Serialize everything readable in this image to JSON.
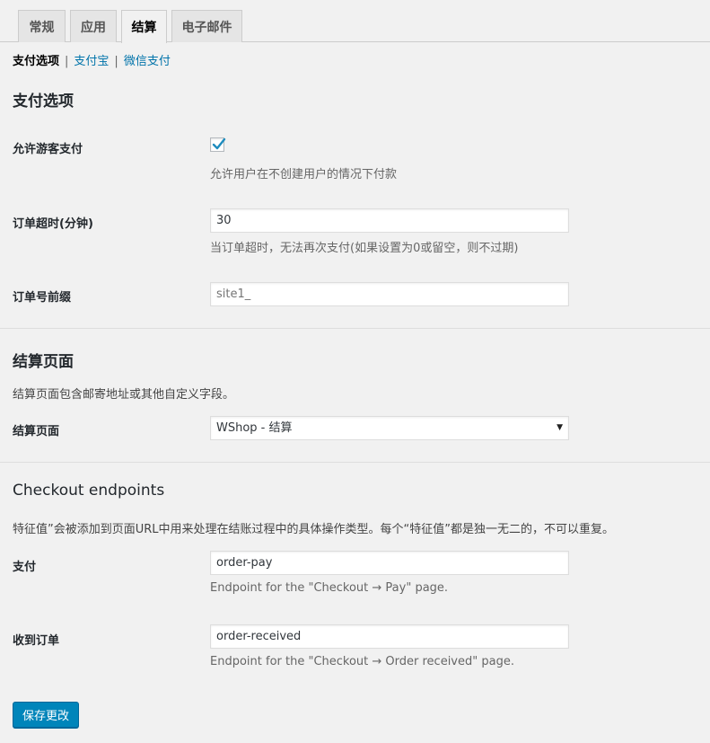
{
  "tabs": [
    {
      "label": "常规",
      "active": false
    },
    {
      "label": "应用",
      "active": false
    },
    {
      "label": "结算",
      "active": true
    },
    {
      "label": "电子邮件",
      "active": false
    }
  ],
  "subnav": {
    "current": "支付选项",
    "separator": "|",
    "links": [
      "支付宝",
      "微信支付"
    ]
  },
  "payment_options": {
    "heading": "支付选项",
    "guest_checkout": {
      "label": "允许游客支付",
      "checked": true,
      "description": "允许用户在不创建用户的情况下付款"
    },
    "order_timeout": {
      "label": "订单超时(分钟)",
      "value": "30",
      "description": "当订单超时，无法再次支付(如果设置为0或留空，则不过期)"
    },
    "order_prefix": {
      "label": "订单号前缀",
      "placeholder": "site1_"
    }
  },
  "checkout_page": {
    "heading": "结算页面",
    "description": "结算页面包含邮寄地址或其他自定义字段。",
    "page_select": {
      "label": "结算页面",
      "selected": "WShop - 结算"
    }
  },
  "endpoints": {
    "heading": "Checkout endpoints",
    "description": "特征值”会被添加到页面URL中用来处理在结账过程中的具体操作类型。每个“特征值”都是独一无二的，不可以重复。",
    "pay": {
      "label": "支付",
      "value": "order-pay",
      "description": "Endpoint for the \"Checkout → Pay\" page."
    },
    "received": {
      "label": "收到订单",
      "value": "order-received",
      "description": "Endpoint for the \"Checkout → Order received\" page."
    }
  },
  "save_button": "保存更改",
  "colors": {
    "accent": "#0085ba",
    "link": "#0073aa",
    "background": "#f1f1f1"
  }
}
